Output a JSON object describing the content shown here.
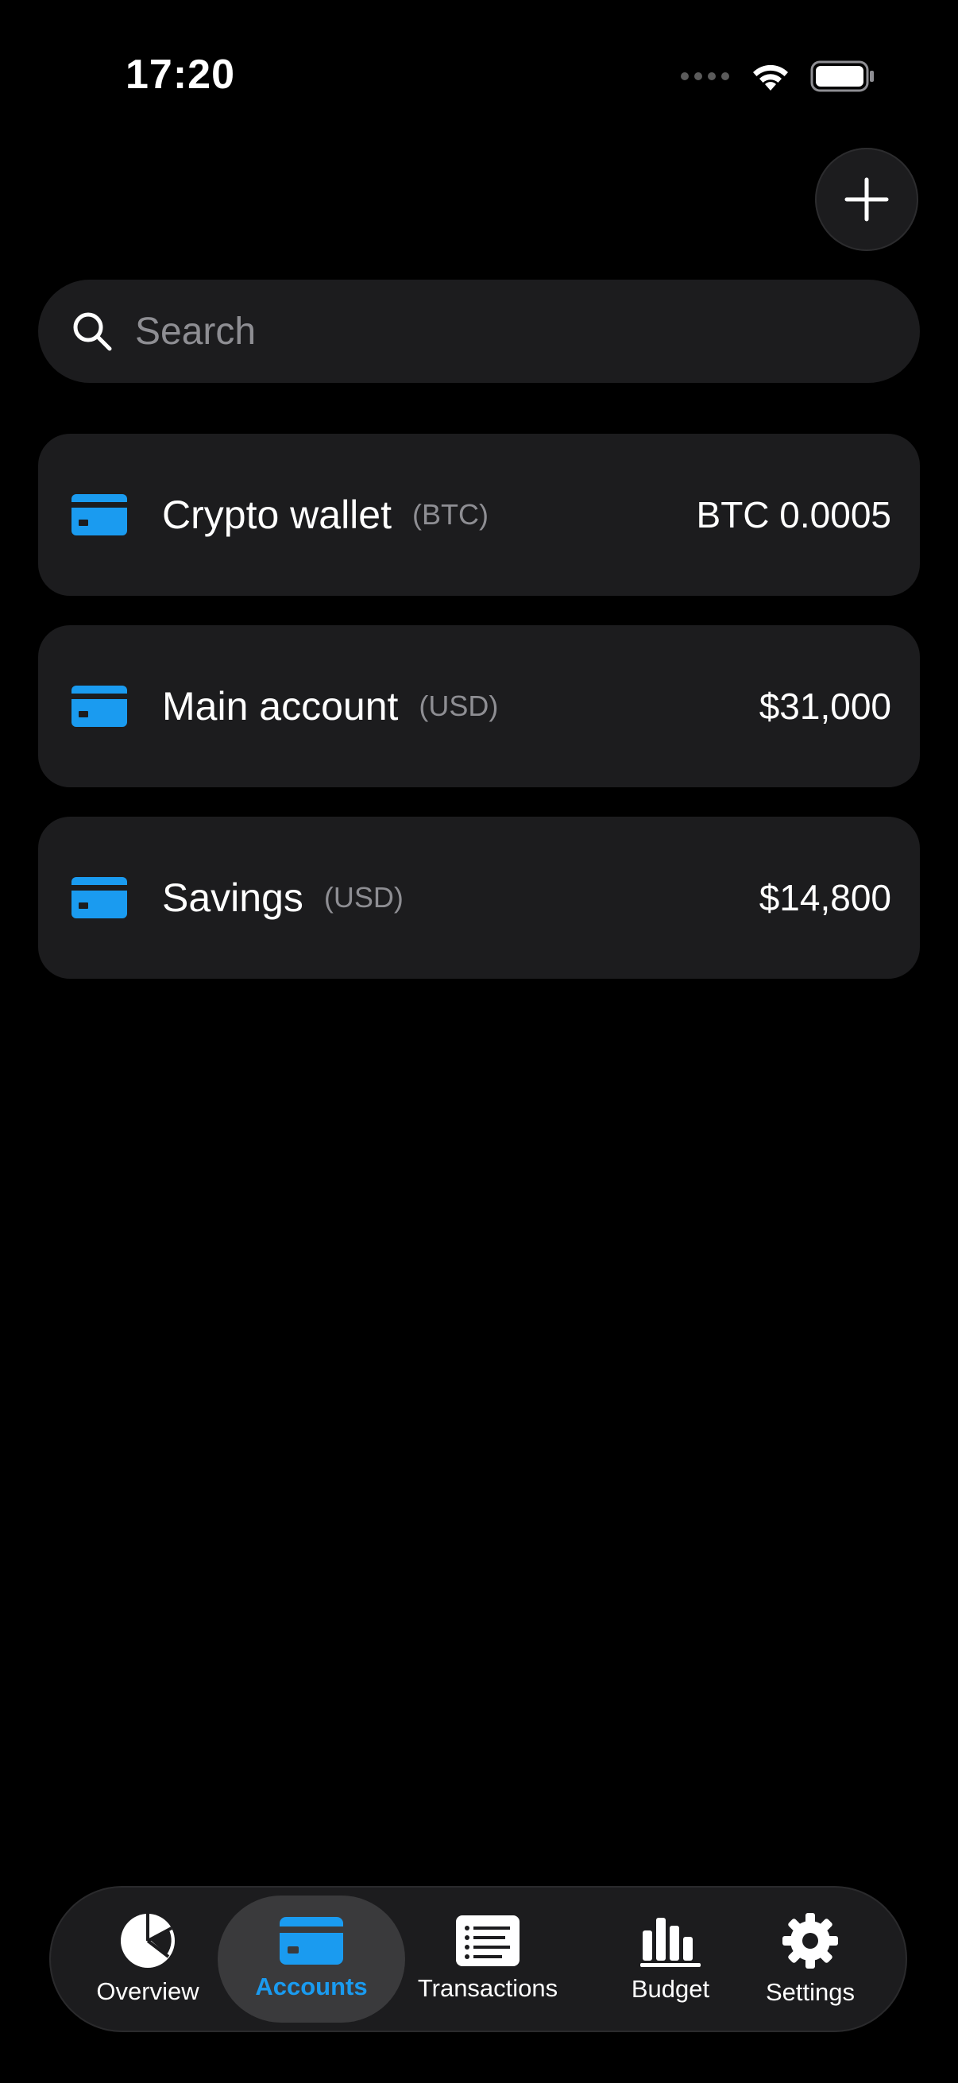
{
  "status_bar": {
    "time": "17:20"
  },
  "header": {
    "add_button_icon": "plus-icon"
  },
  "search": {
    "placeholder": "Search",
    "value": ""
  },
  "accounts": [
    {
      "name": "Crypto wallet",
      "currency": "(BTC)",
      "balance": "BTC 0.0005",
      "icon": "credit-card-icon"
    },
    {
      "name": "Main account",
      "currency": "(USD)",
      "balance": "$31,000",
      "icon": "credit-card-icon"
    },
    {
      "name": "Savings",
      "currency": "(USD)",
      "balance": "$14,800",
      "icon": "credit-card-icon"
    }
  ],
  "tab_bar": {
    "active": "Accounts",
    "tabs": [
      {
        "label": "Overview",
        "icon": "pie-chart-icon"
      },
      {
        "label": "Accounts",
        "icon": "credit-card-icon"
      },
      {
        "label": "Transactions",
        "icon": "list-icon"
      },
      {
        "label": "Budget",
        "icon": "bar-chart-icon"
      },
      {
        "label": "Settings",
        "icon": "gear-icon"
      }
    ]
  },
  "colors": {
    "background": "#000000",
    "card": "#1c1c1e",
    "accent": "#1a9bf0",
    "secondary_text": "#8e8e93"
  }
}
